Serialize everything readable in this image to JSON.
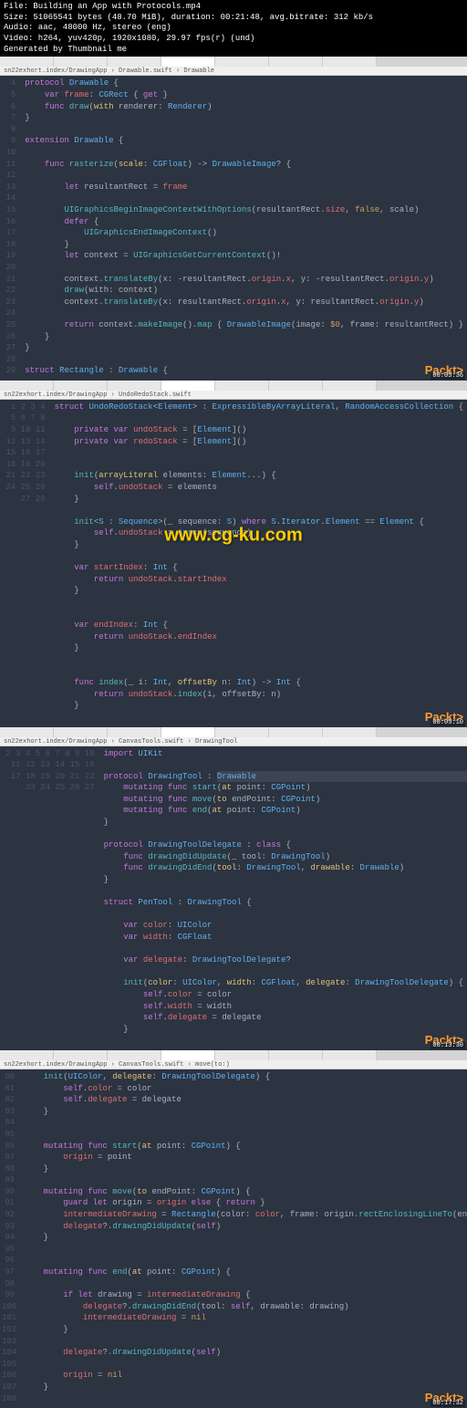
{
  "header": {
    "file": "File: Building an App with Protocols.mp4",
    "size": "Size: 51065541 bytes (48.70 MiB), duration: 00:21:48, avg.bitrate: 312 kb/s",
    "audio": "Audio: aac, 48000 Hz, stereo (eng)",
    "video": "Video: h264, yuv420p, 1920x1080, 29.97 fps(r) (und)",
    "gen": "Generated by Thumbnail me"
  },
  "watermark": "www.cg-ku.com",
  "packt": "Packt>",
  "panels": [
    {
      "timestamp": "00:05:36",
      "breadcrumb": "   sn22exhort.index/DrawingApp › Drawable.swift › Drawable",
      "start": 4,
      "lines": [
        "<span class='kw'>protocol</span> <span class='type'>Drawable</span> {",
        "    <span class='kw'>var</span> <span class='prop'>frame</span>: <span class='type'>CGRect</span> { <span class='kw'>get</span> }",
        "    <span class='kw'>func</span> <span class='fn'>draw</span>(<span class='param'>with</span> renderer: <span class='type'>Renderer</span>)",
        "}",
        "",
        "<span class='kw'>extension</span> <span class='type'>Drawable</span> {",
        "",
        "    <span class='kw'>func</span> <span class='fn'>rasterize</span>(<span class='param'>scale</span>: <span class='type'>CGFloat</span>) -> <span class='type'>DrawableImage</span>? {",
        "        ",
        "        <span class='kw'>let</span> resultantRect = <span class='prop'>frame</span>",
        "",
        "        <span class='fn'>UIGraphicsBeginImageContextWithOptions</span>(resultantRect.<span class='prop'>size</span>, <span class='num'>false</span>, scale)",
        "        <span class='kw'>defer</span> {",
        "            <span class='fn'>UIGraphicsEndImageContext</span>()",
        "        }",
        "        <span class='kw'>let</span> context = <span class='fn'>UIGraphicsGetCurrentContext</span>()!",
        "",
        "        context.<span class='fn'>translateBy</span>(x: -resultantRect.<span class='prop'>origin</span>.<span class='prop'>x</span>, y: -resultantRect.<span class='prop'>origin</span>.<span class='prop'>y</span>)",
        "        <span class='fn'>draw</span>(with: context)",
        "        context.<span class='fn'>translateBy</span>(x: resultantRect.<span class='prop'>origin</span>.<span class='prop'>x</span>, y: resultantRect.<span class='prop'>origin</span>.<span class='prop'>y</span>)",
        "",
        "        <span class='kw'>return</span> context.<span class='fn'>makeImage</span>().<span class='fn'>map</span> { <span class='type'>DrawableImage</span>(image: <span class='num'>$0</span>, frame: resultantRect) }",
        "    }",
        "}",
        "",
        "<span class='kw'>struct</span> <span class='type'>Rectangle</span> : <span class='type'>Drawable</span> {"
      ]
    },
    {
      "timestamp": "00:05:10",
      "breadcrumb": "   sn22exhort.index/DrawingApp › UndoRedoStack.swift",
      "start": 1,
      "lines": [
        "<span class='kw'>struct</span> <span class='type'>UndoRedoStack</span>&lt;<span class='type'>Element</span>&gt; : <span class='type'>ExpressibleByArrayLiteral</span>, <span class='type'>RandomAccessCollection</span> {",
        "",
        "    <span class='kw'>private var</span> <span class='prop'>undoStack</span> = [<span class='type'>Element</span>]()",
        "    <span class='kw'>private var</span> <span class='prop'>redoStack</span> = [<span class='type'>Element</span>]()",
        "",
        "",
        "    <span class='fn'>init</span>(<span class='param'>arrayLiteral</span> elements: <span class='type'>Element</span>...) {",
        "        <span class='kw'>self</span>.<span class='prop'>undoStack</span> = elements",
        "    }",
        "",
        "    <span class='fn'>init</span>&lt;<span class='type'>S</span> : <span class='type'>Sequence</span>&gt;(<span class='param'>_</span> sequence: <span class='type'>S</span>) <span class='kw'>where</span> <span class='type'>S</span>.<span class='type'>Iterator</span>.<span class='type'>Element</span> == <span class='type'>Element</span> {",
        "        <span class='kw'>self</span>.<span class='prop'>undoStack</span> = <span class='type'>Array</span>(sequence)",
        "    }",
        "",
        "    <span class='kw'>var</span> <span class='prop'>startIndex</span>: <span class='type'>Int</span> {",
        "        <span class='kw'>return</span> <span class='prop'>undoStack</span>.<span class='prop'>startIndex</span>",
        "    }",
        "",
        "",
        "    <span class='kw'>var</span> <span class='prop'>endIndex</span>: <span class='type'>Int</span> {",
        "        <span class='kw'>return</span> <span class='prop'>undoStack</span>.<span class='prop'>endIndex</span>",
        "    }",
        "",
        "",
        "    <span class='kw'>func</span> <span class='fn'>index</span>(<span class='param'>_</span> i: <span class='type'>Int</span>, <span class='param'>offsetBy</span> n: <span class='type'>Int</span>) -> <span class='type'>Int</span> {",
        "        <span class='kw'>return</span> <span class='prop'>undoStack</span>.<span class='fn'>index</span>(i, offsetBy: n)",
        "    }",
        ""
      ]
    },
    {
      "timestamp": "00:13:30",
      "breadcrumb": "   sn22exhort.index/DrawingApp › CanvasTools.swift › DrawingTool",
      "start": 2,
      "lines": [
        "<span class='kw'>import</span> <span class='type'>UIKit</span>",
        "",
        "<span class='kw'>protocol</span> <span class='type'>DrawingTool</span> : <span class='type hl'>Drawable</span> {",
        "    <span class='kw'>mutating func</span> <span class='fn'>start</span>(<span class='param'>at</span> point: <span class='type'>CGPoint</span>)",
        "    <span class='kw'>mutating func</span> <span class='fn'>move</span>(<span class='param'>to</span> endPoint: <span class='type'>CGPoint</span>)",
        "    <span class='kw'>mutating func</span> <span class='fn'>end</span>(<span class='param'>at</span> point: <span class='type'>CGPoint</span>)",
        "}",
        "",
        "<span class='kw'>protocol</span> <span class='type'>DrawingToolDelegate</span> : <span class='kw'>class</span> {",
        "    <span class='kw'>func</span> <span class='fn'>drawingDidUpdate</span>(<span class='param'>_</span> tool: <span class='type'>DrawingTool</span>)",
        "    <span class='kw'>func</span> <span class='fn'>drawingDidEnd</span>(<span class='param'>tool</span>: <span class='type'>DrawingTool</span>, <span class='param'>drawable</span>: <span class='type'>Drawable</span>)",
        "}",
        "",
        "<span class='kw'>struct</span> <span class='type'>PenTool</span> : <span class='type'>DrawingTool</span> {",
        "",
        "    <span class='kw'>var</span> <span class='prop'>color</span>: <span class='type'>UIColor</span>",
        "    <span class='kw'>var</span> <span class='prop'>width</span>: <span class='type'>CGFloat</span>",
        "",
        "    <span class='kw'>var</span> <span class='prop'>delegate</span>: <span class='type'>DrawingToolDelegate</span>?",
        "",
        "    <span class='fn'>init</span>(<span class='param'>color</span>: <span class='type'>UIColor</span>, <span class='param'>width</span>: <span class='type'>CGFloat</span>, <span class='param'>delegate</span>: <span class='type'>DrawingToolDelegate</span>) {",
        "        <span class='kw'>self</span>.<span class='prop'>color</span> = color",
        "        <span class='kw'>self</span>.<span class='prop'>width</span> = width",
        "        <span class='kw'>self</span>.<span class='prop'>delegate</span> = delegate",
        "    }",
        ""
      ]
    },
    {
      "timestamp": "00:17:32",
      "breadcrumb": "   sn22exhort.index/DrawingApp › CanvasTools.swift › move(to:)",
      "start": 80,
      "lines": [
        "    <span class='fn'>init</span>(<span class='type'>UIColor</span>, <span class='param'>delegate</span>: <span class='type'>DrawingToolDelegate</span>) {",
        "        <span class='kw'>self</span>.<span class='prop'>color</span> = color",
        "        <span class='kw'>self</span>.<span class='prop'>delegate</span> = delegate",
        "    }",
        "",
        "",
        "    <span class='kw'>mutating func</span> <span class='fn'>start</span>(<span class='param'>at</span> point: <span class='type'>CGPoint</span>) {",
        "        <span class='prop'>origin</span> = point",
        "    }",
        "",
        "    <span class='kw'>mutating func</span> <span class='fn'>move</span>(<span class='param'>to</span> endPoint: <span class='type'>CGPoint</span>) {",
        "        <span class='kw'>guard let</span> origin = <span class='prop'>origin</span> <span class='kw'>else</span> { <span class='kw'>return</span> }",
        "        <span class='prop'>intermediateDrawing</span> = <span class='type'>Rectangle</span>(color: <span class='prop'>color</span>, frame: origin.<span class='fn'>rectEnclosingLineTo</span>(endPoint))",
        "        <span class='prop'>delegate</span>?.<span class='fn'>drawingDidUpdate</span>(<span class='kw'>self</span>)",
        "    }",
        "",
        "",
        "    <span class='kw'>mutating func</span> <span class='fn'>end</span>(<span class='param'>at</span> point: <span class='type'>CGPoint</span>) {",
        "",
        "        <span class='kw'>if let</span> drawing = <span class='prop'>intermediateDrawing</span> {",
        "            <span class='prop'>delegate</span>?.<span class='fn'>drawingDidEnd</span>(tool: <span class='kw'>self</span>, drawable: drawing)",
        "            <span class='prop'>intermediateDrawing</span> = <span class='num'>nil</span>",
        "        }",
        "",
        "        <span class='prop'>delegate</span>?.<span class='fn'>drawingDidUpdate</span>(<span class='kw'>self</span>)",
        "",
        "        <span class='prop'>origin</span> = <span class='num'>nil</span>",
        "    }",
        ""
      ]
    }
  ]
}
